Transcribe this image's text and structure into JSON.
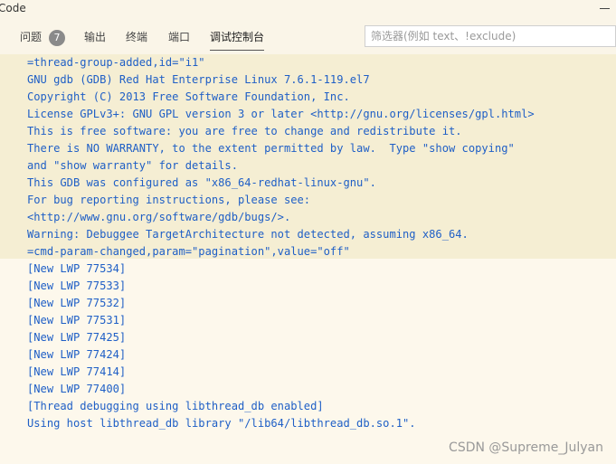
{
  "window": {
    "title": "Code"
  },
  "panel": {
    "tabs": [
      {
        "label": "问题",
        "badge": "7"
      },
      {
        "label": "输出"
      },
      {
        "label": "终端"
      },
      {
        "label": "端口"
      },
      {
        "label": "调试控制台",
        "active": true
      }
    ],
    "filter_placeholder": "筛选器(例如 text、!exclude)"
  },
  "console": {
    "text_color": "#1f5fc6",
    "highlight_color": "#f5eed3",
    "lines": [
      "=thread-group-added,id=\"i1\"",
      "GNU gdb (GDB) Red Hat Enterprise Linux 7.6.1-119.el7",
      "Copyright (C) 2013 Free Software Foundation, Inc.",
      "License GPLv3+: GNU GPL version 3 or later <http://gnu.org/licenses/gpl.html>",
      "This is free software: you are free to change and redistribute it.",
      "There is NO WARRANTY, to the extent permitted by law.  Type \"show copying\"",
      "and \"show warranty\" for details.",
      "This GDB was configured as \"x86_64-redhat-linux-gnu\".",
      "For bug reporting instructions, please see:",
      "<http://www.gnu.org/software/gdb/bugs/>.",
      "Warning: Debuggee TargetArchitecture not detected, assuming x86_64.",
      "=cmd-param-changed,param=\"pagination\",value=\"off\"",
      "[New LWP 77534]",
      "[New LWP 77533]",
      "[New LWP 77532]",
      "[New LWP 77531]",
      "[New LWP 77425]",
      "[New LWP 77424]",
      "[New LWP 77414]",
      "[New LWP 77400]",
      "[Thread debugging using libthread_db enabled]",
      "Using host libthread_db library \"/lib64/libthread_db.so.1\"."
    ]
  },
  "watermark": "CSDN @Supreme_Julyan"
}
